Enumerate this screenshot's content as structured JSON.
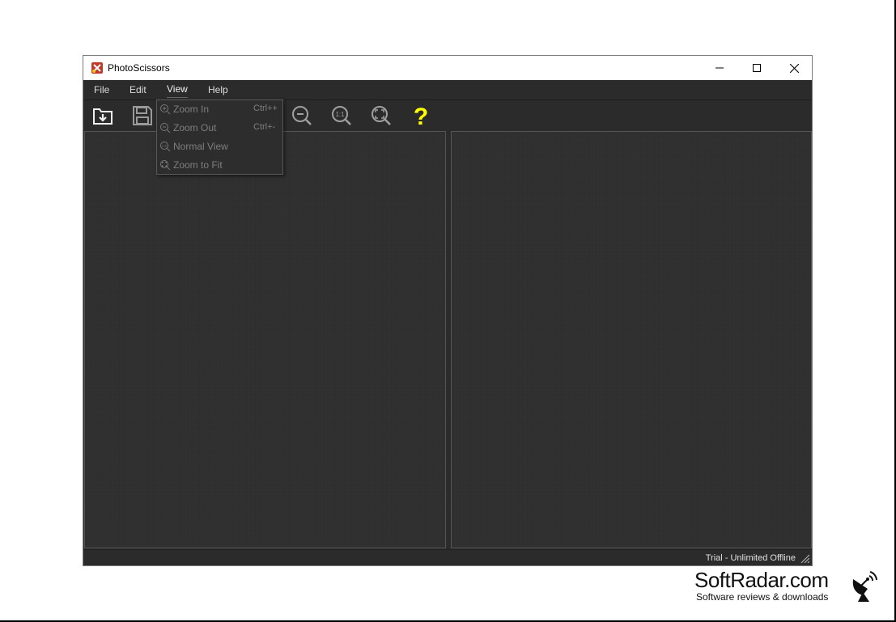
{
  "window": {
    "title": "PhotoScissors"
  },
  "menubar": {
    "items": [
      {
        "label": "File"
      },
      {
        "label": "Edit"
      },
      {
        "label": "View"
      },
      {
        "label": "Help"
      }
    ]
  },
  "toolbar": {
    "buttons": [
      {
        "icon": "open-icon"
      },
      {
        "icon": "save-icon"
      },
      {
        "icon": "zoom-out-icon"
      },
      {
        "icon": "normal-view-icon"
      },
      {
        "icon": "zoom-to-fit-icon"
      },
      {
        "icon": "help-icon"
      }
    ]
  },
  "view_menu": {
    "items": [
      {
        "label": "Zoom In",
        "shortcut": "Ctrl++",
        "icon": "zoom-in-icon"
      },
      {
        "label": "Zoom Out",
        "shortcut": "Ctrl+-",
        "icon": "zoom-out-icon"
      },
      {
        "label": "Normal View",
        "shortcut": "",
        "icon": "normal-view-icon"
      },
      {
        "label": "Zoom to Fit",
        "shortcut": "",
        "icon": "zoom-to-fit-icon"
      }
    ]
  },
  "statusbar": {
    "text": "Trial - Unlimited Offline"
  },
  "watermark": {
    "title": "SoftRadar.com",
    "subtitle": "Software reviews & downloads"
  },
  "colors": {
    "background": "#2b2b2b",
    "help_accent": "#ffff00",
    "disabled_text": "#7e7e7e"
  }
}
